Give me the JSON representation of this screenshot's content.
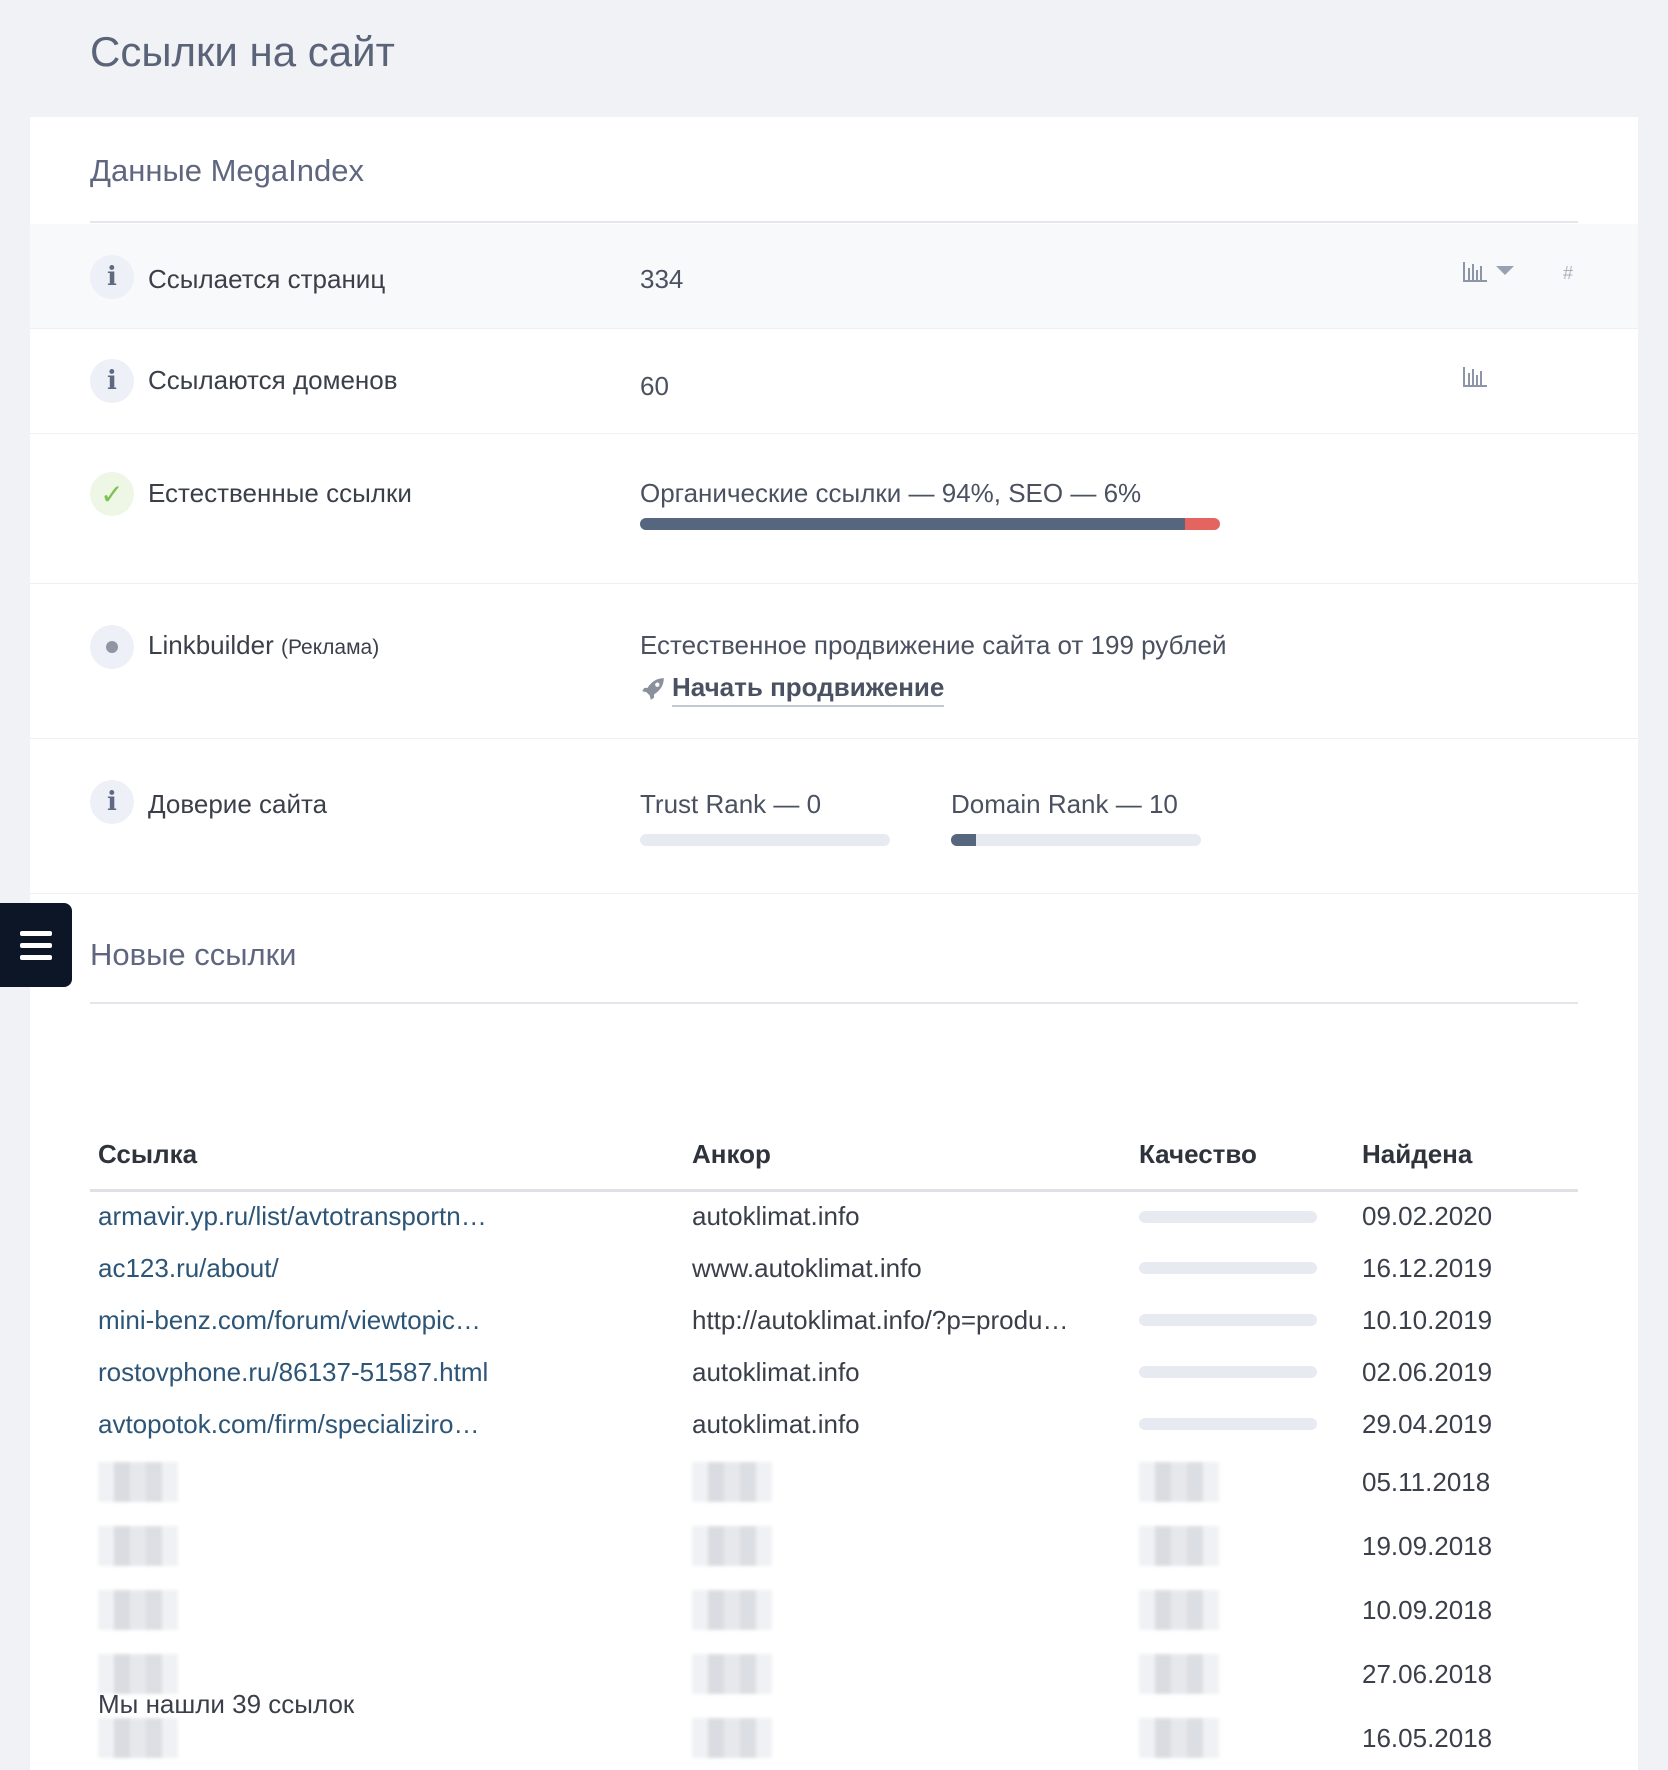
{
  "page": {
    "title": "Ссылки на сайт"
  },
  "megaindex": {
    "title": "Данные MegaIndex",
    "pages_linking": {
      "label": "Ссылается страниц",
      "value": "334"
    },
    "domains_linking": {
      "label": "Ссылаются доменов",
      "value": "60"
    },
    "natural_links": {
      "label": "Естественные ссылки",
      "value": "Органические ссылки — 94%, SEO — 6%",
      "organic_percent": 94,
      "seo_percent": 6
    },
    "linkbuilder": {
      "label": "Linkbuilder",
      "label_suffix": "(Реклама)",
      "text": "Естественное продвижение сайта от 199 рублей",
      "cta": "Начать продвижение"
    },
    "trust": {
      "label": "Доверие сайта",
      "trust_rank_text": "Trust Rank — 0",
      "trust_rank": 0,
      "domain_rank_text": "Domain Rank — 10",
      "domain_rank": 10
    },
    "hash_symbol": "#"
  },
  "new_links": {
    "title": "Новые ссылки",
    "columns": [
      "Ссылка",
      "Анкор",
      "Качество",
      "Найдена"
    ],
    "rows": [
      {
        "link": "armavir.yp.ru/list/avtotransportn…",
        "anchor": "autoklimat.info",
        "date": "09.02.2020"
      },
      {
        "link": "ac123.ru/about/",
        "anchor": "www.autoklimat.info",
        "date": "16.12.2019"
      },
      {
        "link": "mini-benz.com/forum/viewtopic…",
        "anchor": "http://autoklimat.info/?p=produ…",
        "date": "10.10.2019"
      },
      {
        "link": "rostovphone.ru/86137-51587.html",
        "anchor": "autoklimat.info",
        "date": "02.06.2019"
      },
      {
        "link": "avtopotok.com/firm/specializiro…",
        "anchor": "autoklimat.info",
        "date": "29.04.2019"
      }
    ],
    "hidden_rows": [
      {
        "date": "05.11.2018"
      },
      {
        "date": "19.09.2018"
      },
      {
        "date": "10.09.2018"
      },
      {
        "date": "27.06.2018"
      },
      {
        "date": "16.05.2018"
      }
    ],
    "footer": "Мы нашли 39 ссылок"
  },
  "colors": {
    "organic_bar": "#56667f",
    "seo_bar": "#e4655f",
    "link": "#2d5577",
    "menu_bg": "#0d1626"
  },
  "icons": [
    "info-icon",
    "check-icon",
    "dot-icon",
    "rocket-icon",
    "bar-chart-icon",
    "chevron-down-icon",
    "hash-icon",
    "menu-icon"
  ]
}
